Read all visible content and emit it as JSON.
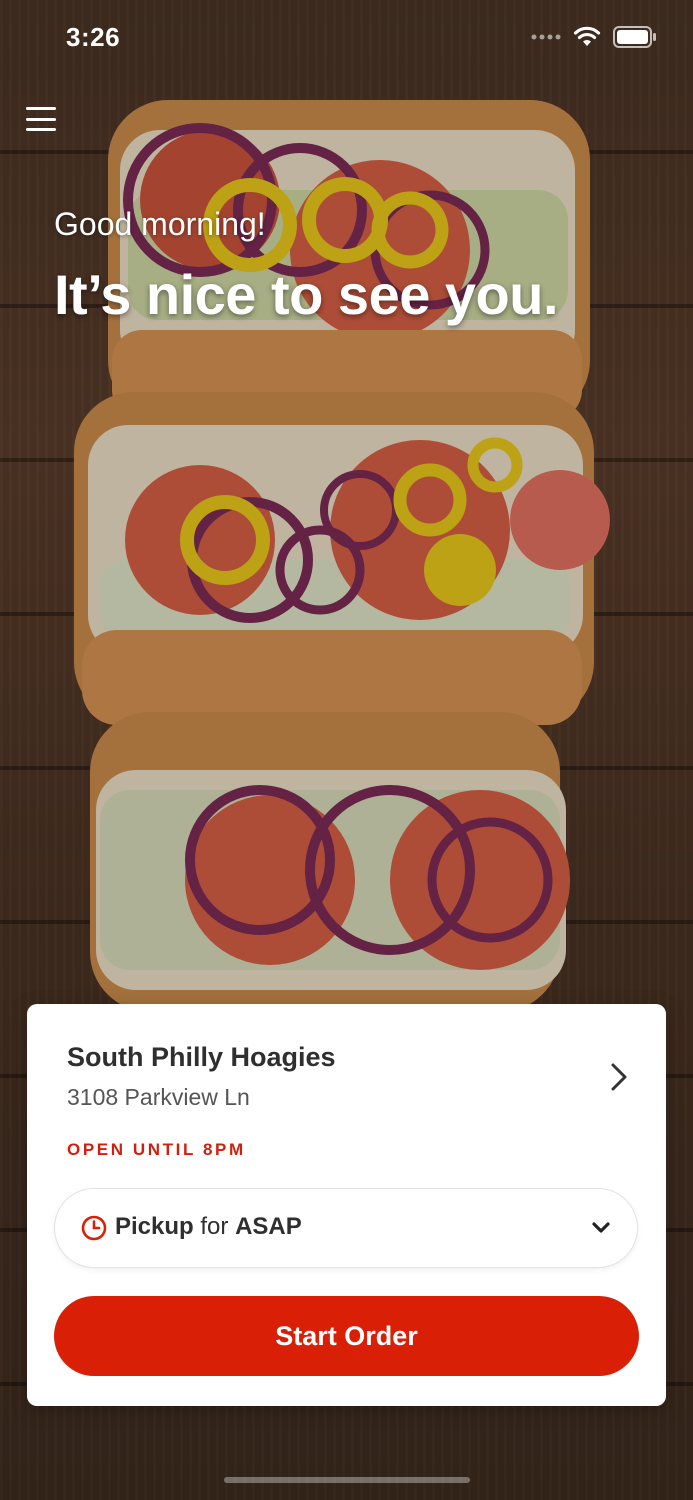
{
  "status_bar": {
    "time": "3:26",
    "icons": [
      "signal-icon",
      "wifi-icon",
      "battery-icon"
    ]
  },
  "header": {
    "menu_icon": "hamburger-menu-icon",
    "greeting": "Good morning!",
    "headline": "It’s nice to see you."
  },
  "store_card": {
    "name": "South Philly Hoagies",
    "address": "3108 Parkview Ln",
    "hours": "OPEN UNTIL 8PM",
    "fulfillment": {
      "mode": "Pickup",
      "connector": "for",
      "time": "ASAP"
    },
    "start_button": "Start Order"
  },
  "colors": {
    "accent": "#d91f05",
    "hours_text": "#d0200d",
    "card_bg": "#ffffff"
  }
}
